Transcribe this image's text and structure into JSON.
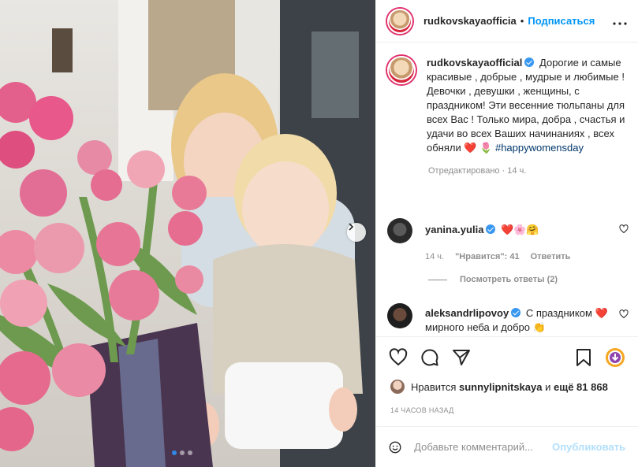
{
  "post": {
    "username_header": "rudkovskayaofficia",
    "separator": "•",
    "follow_label": "Подписаться",
    "more_label": "•••",
    "username": "rudkovskayaofficial",
    "caption": "Дорогие и самые красивые , добрые , мудрые и любимые ! Девочки , девушки , женщины, с праздником! Эти весенние тюльпаны для всех Вас ! Только мира, добра , счастья и удачи во всех Ваших начинаниях , всех обняли ❤️ 🌷",
    "hashtag": "#happywomensday",
    "edited": "Отредактировано · 14 ч."
  },
  "comments": [
    {
      "username": "yanina.yulia",
      "emoji": "❤️🌸🤗",
      "time": "14 ч.",
      "likes": "\"Нравится\": 41",
      "reply_label": "Ответить",
      "view_replies": "Посмотреть ответы (2)"
    },
    {
      "username": "aleksandrlipovoy",
      "text": "С праздником ❤️ мирного неба и добро 👏"
    }
  ],
  "likes": {
    "prefix": "Нравится",
    "user": "sunnylipnitskaya",
    "and": "и",
    "others": "ещё 81 868"
  },
  "timestamp": "14 ЧАСОВ НАЗАД",
  "add_comment": {
    "placeholder": "Добавьте комментарий...",
    "publish_label": "Опубликовать"
  },
  "carousel": {
    "count": 3,
    "active": 1
  },
  "colors": {
    "accent": "#0095f6",
    "verified": "#3897f0",
    "hashtag": "#00376b",
    "muted": "#8e8e8e"
  }
}
